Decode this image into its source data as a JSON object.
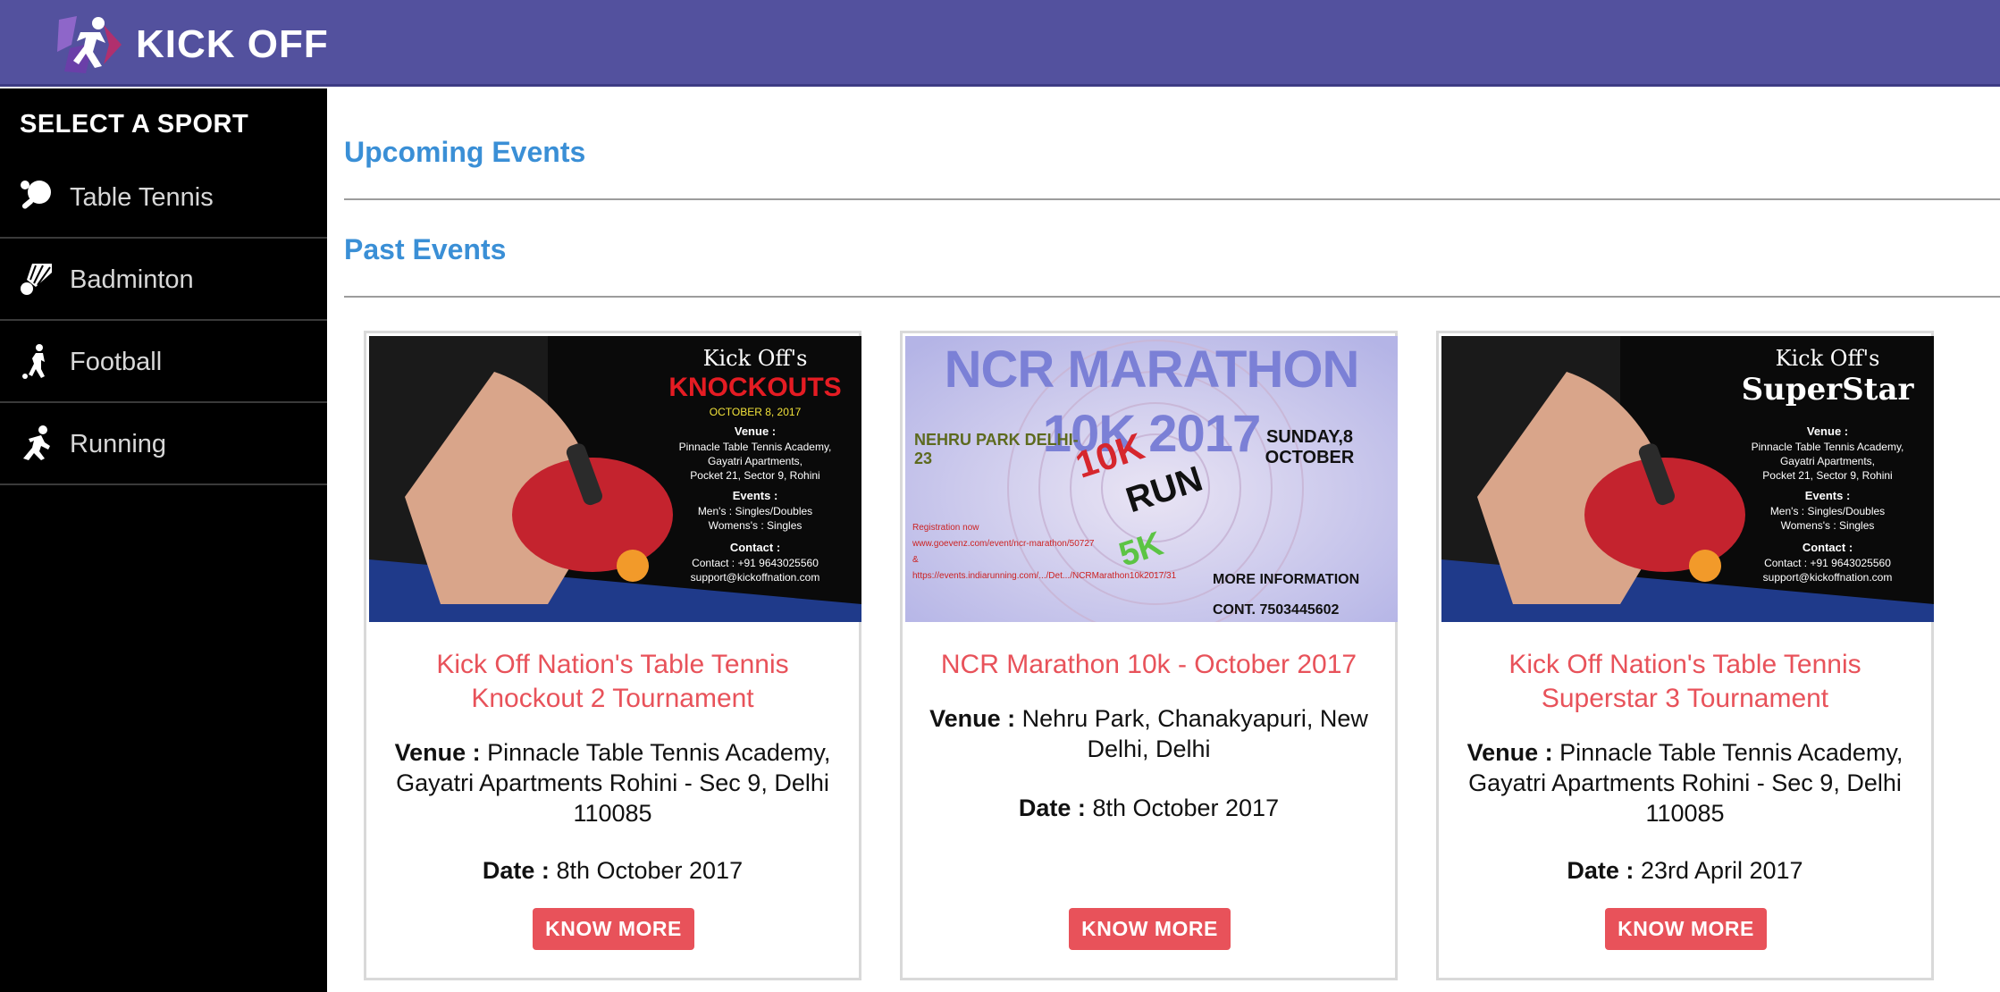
{
  "header": {
    "brand": "KICK OFF",
    "color": "#53519e"
  },
  "sidebar": {
    "heading": "SELECT A SPORT",
    "items": [
      {
        "label": "Table Tennis",
        "icon": "table-tennis-icon"
      },
      {
        "label": "Badminton",
        "icon": "shuttlecock-icon"
      },
      {
        "label": "Football",
        "icon": "football-player-icon"
      },
      {
        "label": "Running",
        "icon": "runner-icon"
      }
    ]
  },
  "main": {
    "upcoming_title": "Upcoming Events",
    "past_title": "Past Events"
  },
  "venue_label": "Venue :",
  "date_label": "Date :",
  "events": [
    {
      "title": "Kick Off Nation's Table Tennis Knockout 2 Tournament",
      "venue": "Pinnacle Table Tennis Academy, Gayatri Apartments Rohini - Sec 9, Delhi 110085",
      "date": "8th October 2017",
      "button": "KNOW MORE",
      "poster": {
        "brand": "Kick Off's",
        "headline": "KNOCKOUTS",
        "date": "OCTOBER 8, 2017",
        "venue_head": "Venue :",
        "venue_lines": [
          "Pinnacle Table Tennis Academy,",
          "Gayatri Apartments,",
          "Pocket 21, Sector 9, Rohini"
        ],
        "events_head": "Events :",
        "events_lines": [
          "Men's : Singles/Doubles",
          "Womens's : Singles"
        ],
        "contact_head": "Contact :",
        "contact_lines": [
          "Contact : +91 9643025560",
          "support@kickoffnation.com"
        ]
      }
    },
    {
      "title": "NCR Marathon 10k - October 2017",
      "venue": "Nehru Park, Chanakyapuri, New Delhi, Delhi",
      "date": "8th October 2017",
      "button": "KNOW MORE",
      "poster": {
        "headline": "NCR MARATHON 10K 2017",
        "location": "NEHRU PARK DELHI-23",
        "day": "SUNDAY,8 OCTOBER",
        "big1": "10K",
        "big2": "RUN",
        "big3": "5K",
        "reg_lines": [
          "Registration now",
          "www.goevenz.com/event/ncr-marathon/50727",
          "&",
          "https://events.indiarunning.com/.../Det.../NCRMarathon10k2017/31"
        ],
        "info1": "MORE INFORMATION",
        "info2": "CONT. 7503445602"
      }
    },
    {
      "title": "Kick Off Nation's Table Tennis Superstar 3 Tournament",
      "venue": "Pinnacle Table Tennis Academy, Gayatri Apartments Rohini - Sec 9, Delhi 110085",
      "date": "23rd April 2017",
      "button": "KNOW MORE",
      "poster": {
        "brand": "Kick Off's",
        "headline": "SuperStar",
        "venue_head": "Venue :",
        "venue_lines": [
          "Pinnacle Table Tennis Academy,",
          "Gayatri Apartments,",
          "Pocket 21, Sector 9, Rohini"
        ],
        "events_head": "Events :",
        "events_lines": [
          "Men's : Singles/Doubles",
          "Womens's : Singles"
        ],
        "contact_head": "Contact :",
        "contact_lines": [
          "Contact : +91 9643025560",
          "support@kickoffnation.com"
        ]
      }
    }
  ],
  "colors": {
    "accent": "#e8525a",
    "link": "#3a8fd6",
    "sidebar": "#000000"
  }
}
